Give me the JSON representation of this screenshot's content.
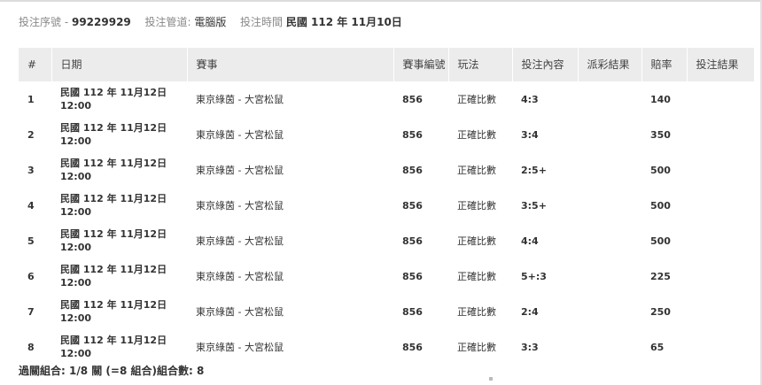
{
  "header": {
    "serial_label": "投注序號 -",
    "serial_value": "99229929",
    "channel_label": "投注管道:",
    "channel_value": "電腦版",
    "time_label": "投注時間",
    "time_value": "民國 112 年 11月10日"
  },
  "table": {
    "columns": [
      "#",
      "日期",
      "賽事",
      "賽事編號",
      "玩法",
      "投注內容",
      "派彩結果",
      "賠率",
      "投注結果"
    ],
    "rows": [
      {
        "num": "1",
        "date": "民國 112 年 11月12日",
        "time": "12:00",
        "match": "東京綠茵 - 大宮松鼠",
        "match_no": "856",
        "play": "正確比數",
        "content": "4:3",
        "payout": "",
        "odds": "140",
        "result": ""
      },
      {
        "num": "2",
        "date": "民國 112 年 11月12日",
        "time": "12:00",
        "match": "東京綠茵 - 大宮松鼠",
        "match_no": "856",
        "play": "正確比數",
        "content": "3:4",
        "payout": "",
        "odds": "350",
        "result": ""
      },
      {
        "num": "3",
        "date": "民國 112 年 11月12日",
        "time": "12:00",
        "match": "東京綠茵 - 大宮松鼠",
        "match_no": "856",
        "play": "正確比數",
        "content": "2:5+",
        "payout": "",
        "odds": "500",
        "result": ""
      },
      {
        "num": "4",
        "date": "民國 112 年 11月12日",
        "time": "12:00",
        "match": "東京綠茵 - 大宮松鼠",
        "match_no": "856",
        "play": "正確比數",
        "content": "3:5+",
        "payout": "",
        "odds": "500",
        "result": ""
      },
      {
        "num": "5",
        "date": "民國 112 年 11月12日",
        "time": "12:00",
        "match": "東京綠茵 - 大宮松鼠",
        "match_no": "856",
        "play": "正確比數",
        "content": "4:4",
        "payout": "",
        "odds": "500",
        "result": ""
      },
      {
        "num": "6",
        "date": "民國 112 年 11月12日",
        "time": "12:00",
        "match": "東京綠茵 - 大宮松鼠",
        "match_no": "856",
        "play": "正確比數",
        "content": "5+:3",
        "payout": "",
        "odds": "225",
        "result": ""
      },
      {
        "num": "7",
        "date": "民國 112 年 11月12日",
        "time": "12:00",
        "match": "東京綠茵 - 大宮松鼠",
        "match_no": "856",
        "play": "正確比數",
        "content": "2:4",
        "payout": "",
        "odds": "250",
        "result": ""
      },
      {
        "num": "8",
        "date": "民國 112 年 11月12日",
        "time": "12:00",
        "match": "東京綠茵 - 大宮松鼠",
        "match_no": "856",
        "play": "正確比數",
        "content": "3:3",
        "payout": "",
        "odds": "65",
        "result": ""
      }
    ]
  },
  "footer": {
    "summary": "過關組合: 1/8 關 (=8 組合)組合數: 8"
  }
}
